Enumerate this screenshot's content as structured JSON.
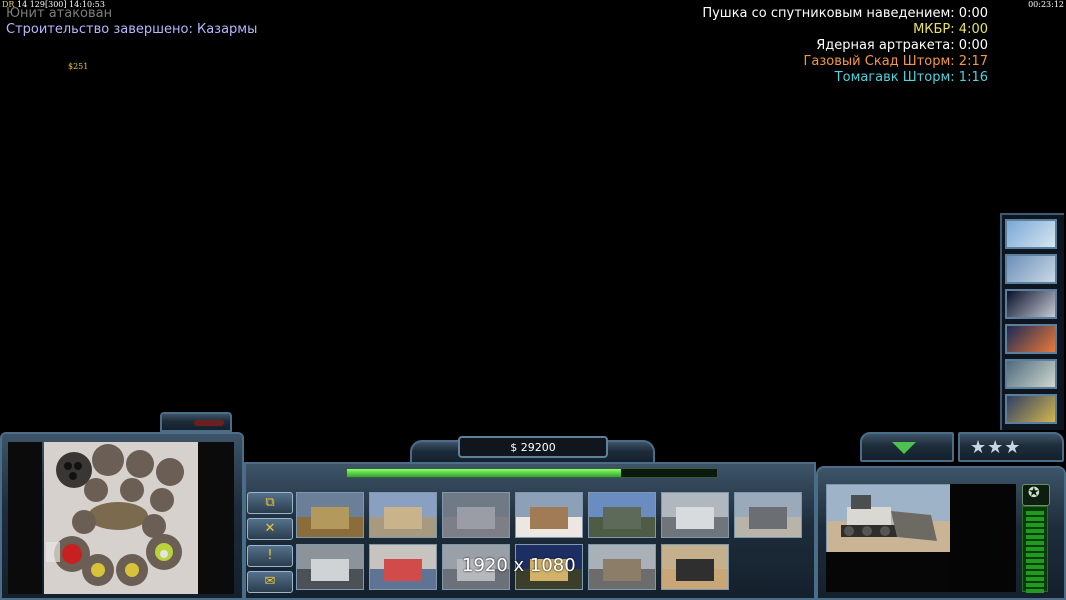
{
  "debug": {
    "prefix": "DR",
    "values": "14  129[300]  14:10:53",
    "right_clock": "00:23:12"
  },
  "messages": {
    "line1": "Юнит атакован",
    "line2_prefix": "Строительство завершено:",
    "line2_value": "Казармы",
    "money_float": "$251"
  },
  "timers": [
    {
      "label": "Пушка со спутниковым наведением:",
      "time": "0:00",
      "color": "#ffffff"
    },
    {
      "label": "МКБР:",
      "time": "4:00",
      "color": "#e9e35a"
    },
    {
      "label": "Ядерная артракета:",
      "time": "0:00",
      "color": "#ffffff"
    },
    {
      "label": "Газовый Скад Шторм:",
      "time": "2:17",
      "color": "#f39a3c"
    },
    {
      "label": "Томагавк Шторм:",
      "time": "1:16",
      "color": "#4ed3df"
    }
  ],
  "general_powers": [
    {
      "icon": "stealth-bomber-icon"
    },
    {
      "icon": "jet-fighter-icon"
    },
    {
      "icon": "satellite-icon"
    },
    {
      "icon": "blast-icon"
    },
    {
      "icon": "magnifier-icon"
    },
    {
      "icon": "paradrop-icon"
    }
  ],
  "hud": {
    "money": "$ 29200",
    "power_fill_fraction": 0.74,
    "side_buttons": [
      "⧉",
      "✕",
      "!",
      "✉"
    ],
    "resolution_label": "1920 x 1080",
    "rank_stars": "★★★"
  },
  "build_items": [
    {
      "name": "command-center",
      "sky": "#6b7f99",
      "ground": "#8a6d3b",
      "bld": "#b39a5c"
    },
    {
      "name": "barracks",
      "sky": "#8aa0c3",
      "ground": "#a79a7f",
      "bld": "#c9b38a"
    },
    {
      "name": "war-factory",
      "sky": "#6f7a86",
      "ground": "#7e7f86",
      "bld": "#9a9da5"
    },
    {
      "name": "airfield",
      "sky": "#8ca0b8",
      "ground": "#ece7e1",
      "bld": "#a07b55"
    },
    {
      "name": "missile-battery",
      "sky": "#6a8cc0",
      "ground": "#4e5b45",
      "bld": "#5d6a5a"
    },
    {
      "name": "supply-center",
      "sky": "#b1b7be",
      "ground": "#70757c",
      "bld": "#d8dbde"
    },
    {
      "name": "strategy-center",
      "sky": "#9aaabb",
      "ground": "#b9b4aa",
      "bld": "#6b6e72"
    },
    {
      "name": "particle-cannon",
      "sky": "#8c939a",
      "ground": "#4c5157",
      "bld": "#d0d3d6"
    },
    {
      "name": "fire-base",
      "sky": "#c7c4c0",
      "ground": "#5f7494",
      "bld": "#d24b4b"
    },
    {
      "name": "patriot",
      "sky": "#9aa0a8",
      "ground": "#6c7078",
      "bld": "#b5b8bd"
    },
    {
      "name": "power-plant",
      "sky": "#1d2e63",
      "ground": "#3b3f2a",
      "bld": "#d2b26a"
    },
    {
      "name": "detention-camp",
      "sky": "#aab0b8",
      "ground": "#6c6c6c",
      "bld": "#8c7d68"
    },
    {
      "name": "scan-radar",
      "sky": "#c4b08c",
      "ground": "#c9a677",
      "bld": "#2f2f2f"
    }
  ],
  "unit": {
    "name": "dozer"
  },
  "colors": {
    "metal_light": "#4c6d88",
    "power_bar": "#4ec04e",
    "money_text": "#ffffff"
  }
}
